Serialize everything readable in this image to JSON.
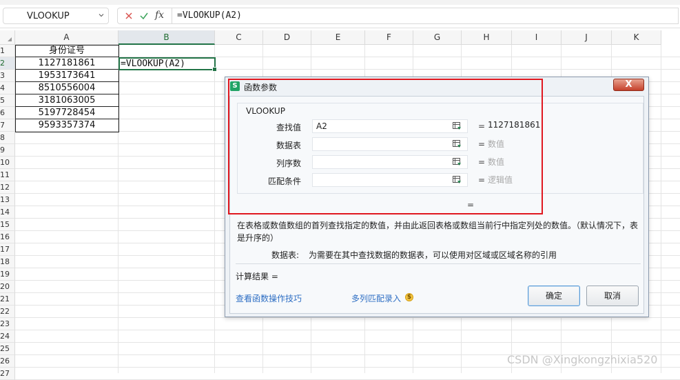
{
  "formula_bar": {
    "name_box": "VLOOKUP",
    "cancel_icon": "close-icon",
    "enter_icon": "check-icon",
    "fx_label": "fx",
    "formula": "=VLOOKUP(A2)"
  },
  "sheet": {
    "columns": [
      "A",
      "B",
      "C",
      "D",
      "E",
      "F",
      "G",
      "H",
      "I",
      "J",
      "K"
    ],
    "rows": [
      "1",
      "2",
      "3",
      "4",
      "5",
      "6",
      "7",
      "8",
      "9",
      "10",
      "11",
      "12",
      "13",
      "14",
      "15",
      "16",
      "17",
      "18",
      "19",
      "20",
      "21",
      "22",
      "23",
      "24",
      "25",
      "26",
      "27"
    ],
    "selected_column": "B",
    "selected_row": "2",
    "column_a": [
      "身份证号",
      "1127181861",
      "1953173641",
      "8510556004",
      "3181063005",
      "5197728454",
      "9593357374"
    ],
    "active_cell_text": "=VLOOKUP(A2)"
  },
  "dialog": {
    "title": "函数参数",
    "logo": "S",
    "close_label": "X",
    "function_name": "VLOOKUP",
    "args": [
      {
        "label": "查找值",
        "value": "A2",
        "eq": "=",
        "result": "1127181861",
        "hint": false
      },
      {
        "label": "数据表",
        "value": "",
        "eq": "=",
        "result": "数值",
        "hint": true
      },
      {
        "label": "列序数",
        "value": "",
        "eq": "=",
        "result": "数值",
        "hint": true
      },
      {
        "label": "匹配条件",
        "value": "",
        "eq": "=",
        "result": "逻辑值",
        "hint": true
      }
    ],
    "result_eq": "=",
    "description": "在表格或数值数组的首列查找指定的数值，并由此返回表格或数组当前行中指定列处的数值。（默认情况下，表是升序的）",
    "arg_help_name": "数据表:",
    "arg_help_text": "为需要在其中查找数据的数据表，可以使用对区域或区域名称的引用",
    "calc_result": "计算结果 =",
    "link_tips": "查看函数操作技巧",
    "link_multi": "多列匹配录入",
    "coin_symbol": "$",
    "ok_label": "确定",
    "cancel_label": "取消",
    "colors": {
      "accent_green": "#217346",
      "highlight_red": "#e0161e",
      "link_blue": "#2f6fc4"
    }
  },
  "watermark": "CSDN @Xingkongzhixia520"
}
